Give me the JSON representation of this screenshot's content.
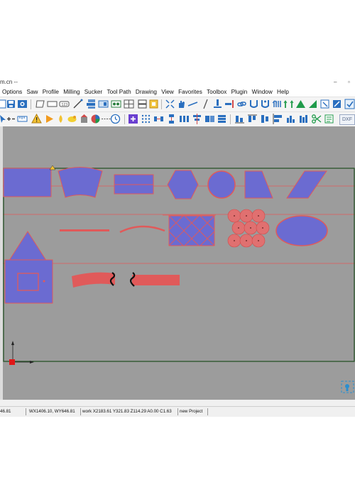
{
  "window": {
    "title": "m.cn --",
    "controls": {
      "minimize": "–",
      "restore": "▫"
    }
  },
  "menu": [
    "Options",
    "Saw",
    "Profile",
    "Milling",
    "Sucker",
    "Tool Path",
    "Drawing",
    "View",
    "Favorites",
    "Toolbox",
    "Plugin",
    "Window",
    "Help"
  ],
  "toolbar_right_label": "DXF",
  "status": {
    "field1": "46.81",
    "field2": "WX1406.10, WY646.81",
    "field3": "work X2183.61 Y321.83 Z114.29 A0.00 C1.63",
    "field4": "new Project"
  },
  "colors": {
    "canvas": "#9c9c9c",
    "shape_fill": "#6b6bd1",
    "shape_stroke": "#e05a5a",
    "guide_line": "#e05a5a",
    "boundary": "#1f4d1f",
    "cut_fill": "#e06060"
  }
}
